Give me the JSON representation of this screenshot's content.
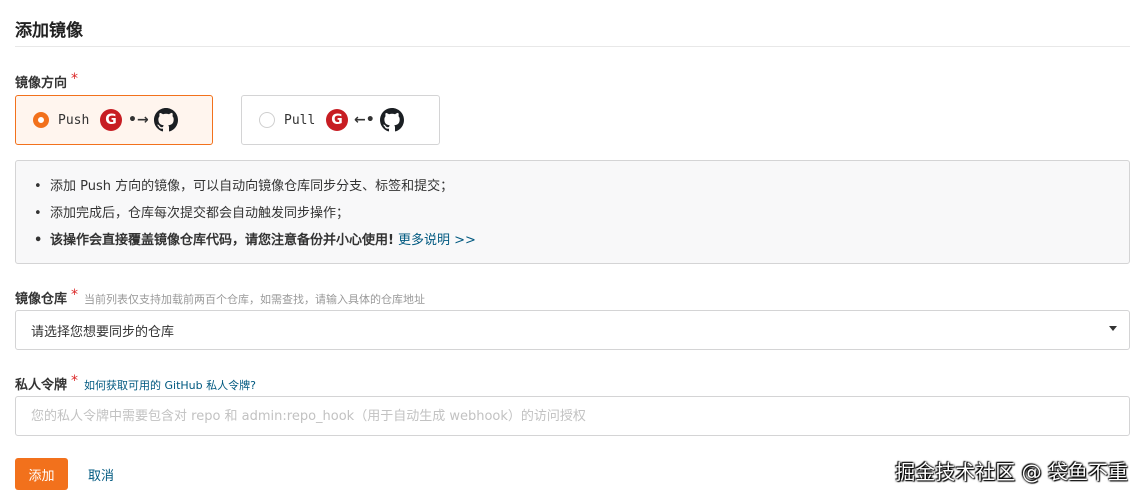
{
  "header": {
    "title": "添加镜像"
  },
  "direction": {
    "label": "镜像方向",
    "required_mark": "*",
    "options": [
      {
        "label": "Push",
        "arrow": "•→",
        "selected": true
      },
      {
        "label": "Pull",
        "arrow": "←•",
        "selected": false
      }
    ],
    "gitee_glyph": "G",
    "icons": [
      "gitee-icon",
      "github-icon"
    ]
  },
  "notice": {
    "items": [
      "添加 Push 方向的镜像，可以自动向镜像仓库同步分支、标签和提交；",
      "添加完成后，仓库每次提交都会自动触发同步操作；",
      "该操作会直接覆盖镜像仓库代码，请您注意备份并小心使用!"
    ],
    "more_link": "更多说明 >>"
  },
  "repo": {
    "label": "镜像仓库",
    "required_mark": "*",
    "hint": "当前列表仅支持加载前两百个仓库，如需查找，请输入具体的仓库地址",
    "select_value": "请选择您想要同步的仓库"
  },
  "token": {
    "label": "私人令牌",
    "required_mark": "*",
    "help_link": "如何获取可用的 GitHub 私人令牌?",
    "placeholder": "您的私人令牌中需要包含对 repo 和 admin:repo_hook（用于自动生成 webhook）的访问授权",
    "value": ""
  },
  "actions": {
    "add_label": "添加",
    "cancel_label": "取消"
  },
  "watermark": "掘金技术社区 @ 袋鱼不重",
  "colors": {
    "accent": "#f2711c",
    "link": "#005980",
    "required": "#db2828",
    "gitee": "#c71d23"
  }
}
